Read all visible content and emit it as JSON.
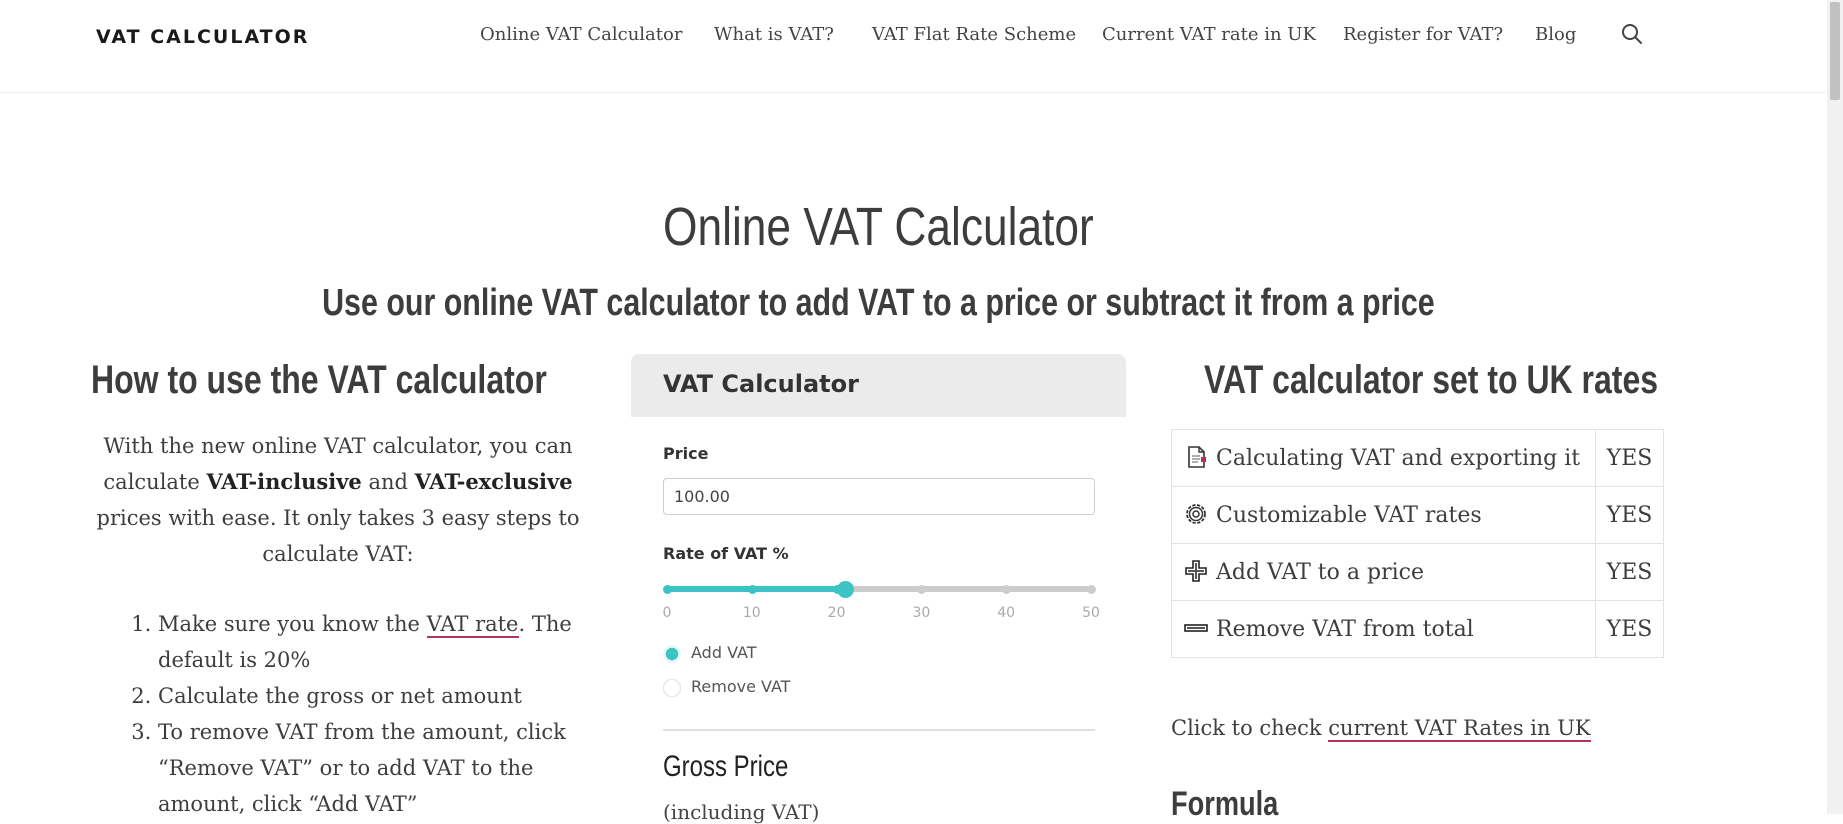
{
  "header": {
    "logo": "VAT CALCULATOR",
    "nav": [
      {
        "label": "Online VAT Calculator"
      },
      {
        "label": "What is VAT?"
      },
      {
        "label": "VAT Flat Rate Scheme"
      },
      {
        "label": "Current VAT rate in UK"
      },
      {
        "label": "Register for VAT?"
      },
      {
        "label": "Blog"
      }
    ],
    "search_icon": "search-icon"
  },
  "page": {
    "title": "Online VAT Calculator",
    "subtitle": "Use our online VAT calculator to add VAT to a price or subtract it from a price"
  },
  "howto": {
    "title": "How to use the VAT calculator",
    "intro_1": "With the new online VAT calculator, you can calculate ",
    "intro_bold_1": "VAT-inclusive",
    "intro_2": " and ",
    "intro_bold_2": "VAT-exclusive",
    "intro_3": " prices with ease. It only takes 3 easy steps to calculate VAT:",
    "step1_before": "Make sure you know the ",
    "step1_link": "VAT rate",
    "step1_after": ". The default is 20%",
    "step2": "Calculate the gross or net amount",
    "step3": "To remove VAT from the amount, click “Remove VAT” or to add VAT to the amount, click “Add VAT”"
  },
  "calculator": {
    "title": "VAT Calculator",
    "price_label": "Price",
    "price_value": "100.00",
    "rate_label": "Rate of VAT %",
    "rate_value": 21,
    "rate_min": 0,
    "rate_max": 50,
    "ticks": [
      "0",
      "10",
      "20",
      "30",
      "40",
      "50"
    ],
    "options": [
      {
        "label": "Add VAT",
        "checked": true
      },
      {
        "label": "Remove VAT",
        "checked": false
      }
    ],
    "gross_title": "Gross Price",
    "gross_sub": "(including VAT)",
    "accent_color": "#3cc4c4"
  },
  "features": {
    "title": "VAT calculator set to UK rates",
    "rows": [
      {
        "icon": "document-icon",
        "label": "Calculating VAT and exporting it",
        "value": "YES"
      },
      {
        "icon": "gear-icon",
        "label": "Customizable VAT rates",
        "value": "YES"
      },
      {
        "icon": "plus-icon",
        "label": "Add VAT to a price",
        "value": "YES"
      },
      {
        "icon": "minus-icon",
        "label": "Remove VAT from total",
        "value": "YES"
      }
    ],
    "check_text": "Click to check ",
    "check_link": "current VAT Rates in UK",
    "formula_title": "Formula"
  },
  "colors": {
    "link_underline": "#b0355a",
    "text": "#3d3d3d"
  }
}
